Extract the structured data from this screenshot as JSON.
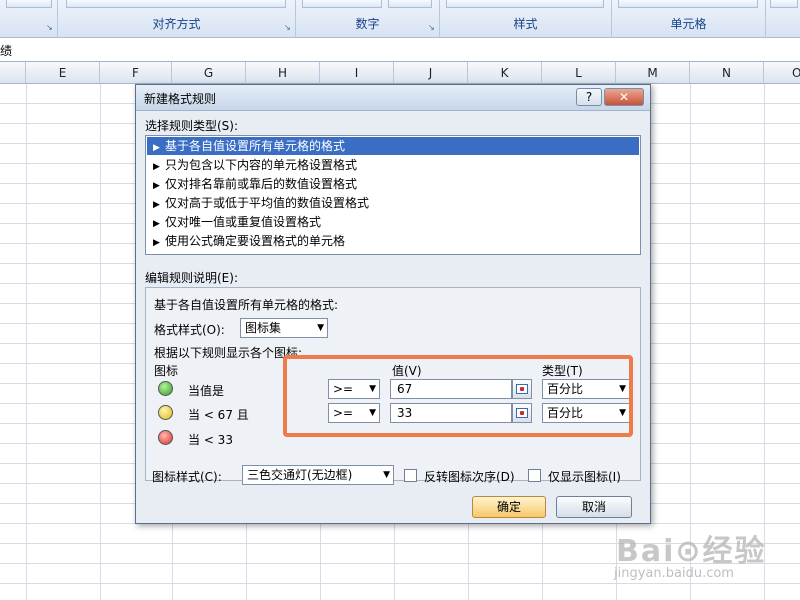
{
  "ribbon": {
    "groups": [
      {
        "label": "",
        "launcher": "↘"
      },
      {
        "label": "对齐方式",
        "launcher": "↘"
      },
      {
        "label": "数字",
        "launcher": "↘"
      },
      {
        "label": "样式",
        "launcher": ""
      },
      {
        "label": "单元格",
        "launcher": ""
      },
      {
        "label": "",
        "launcher": ""
      }
    ]
  },
  "formula_bar": {
    "text": "绩"
  },
  "columns": [
    "E",
    "F",
    "G",
    "H",
    "I",
    "J",
    "K",
    "L",
    "M",
    "N",
    "O"
  ],
  "dialog": {
    "title": "新建格式规则",
    "help_label": "?",
    "close_label": "✕",
    "select_rule_type_label": "选择规则类型(S):",
    "rule_types": [
      "基于各自值设置所有单元格的格式",
      "只为包含以下内容的单元格设置格式",
      "仅对排名靠前或靠后的数值设置格式",
      "仅对高于或低于平均值的数值设置格式",
      "仅对唯一值或重复值设置格式",
      "使用公式确定要设置格式的单元格"
    ],
    "selected_rule_index": 0,
    "edit_desc_label": "编辑规则说明(E):",
    "desc_heading": "基于各自值设置所有单元格的格式:",
    "format_style_label": "格式样式(O):",
    "format_style_value": "图标集",
    "show_rule_label": "根据以下规则显示各个图标:",
    "icon_header": "图标",
    "value_header": "值(V)",
    "type_header": "类型(T)",
    "rules": [
      {
        "icon": "green-circle",
        "text": "当值是",
        "operator": ">=",
        "value": "67",
        "type": "百分比"
      },
      {
        "icon": "yellow-circle",
        "text": "当 < 67 且",
        "operator": ">=",
        "value": "33",
        "type": "百分比"
      },
      {
        "icon": "red-circle",
        "text": "当 < 33"
      }
    ],
    "icon_style_label": "图标样式(C):",
    "icon_style_value": "三色交通灯(无边框)",
    "reverse_order_label": "反转图标次序(D)",
    "show_icon_only_label": "仅显示图标(I)",
    "ok_label": "确定",
    "cancel_label": "取消"
  },
  "colors": {
    "selection": "#3a6ec4",
    "highlight_border": "#f07a4a",
    "ribbon_label": "#15428b"
  }
}
